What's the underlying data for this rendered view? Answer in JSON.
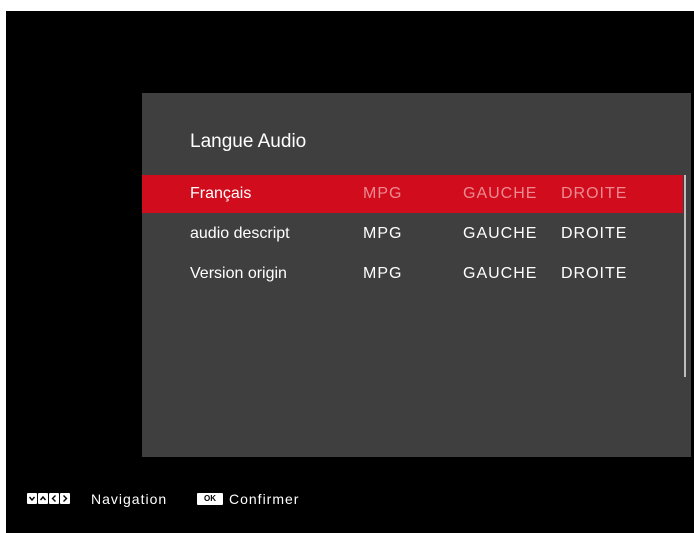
{
  "panel": {
    "title": "Langue Audio",
    "rows": [
      {
        "name": "Français",
        "codec": "MPG",
        "left": "GAUCHE",
        "right": "DROITE",
        "selected": true
      },
      {
        "name": "audio descript",
        "codec": "MPG",
        "left": "GAUCHE",
        "right": "DROITE",
        "selected": false
      },
      {
        "name": "Version origin",
        "codec": "MPG",
        "left": "GAUCHE",
        "right": "DROITE",
        "selected": false
      }
    ]
  },
  "footer": {
    "nav_keys": [
      "down-arrow-key-icon",
      "up-arrow-key-icon",
      "left-arrow-key-icon",
      "right-arrow-key-icon"
    ],
    "nav_label": "Navigation",
    "ok_key": "OK",
    "ok_label": "Confirmer"
  },
  "colors": {
    "background": "#000000",
    "panel": "#3f3f3f",
    "selection": "#d10c1c",
    "selected_dim_text": "#ee8a92",
    "text": "#ffffff"
  }
}
